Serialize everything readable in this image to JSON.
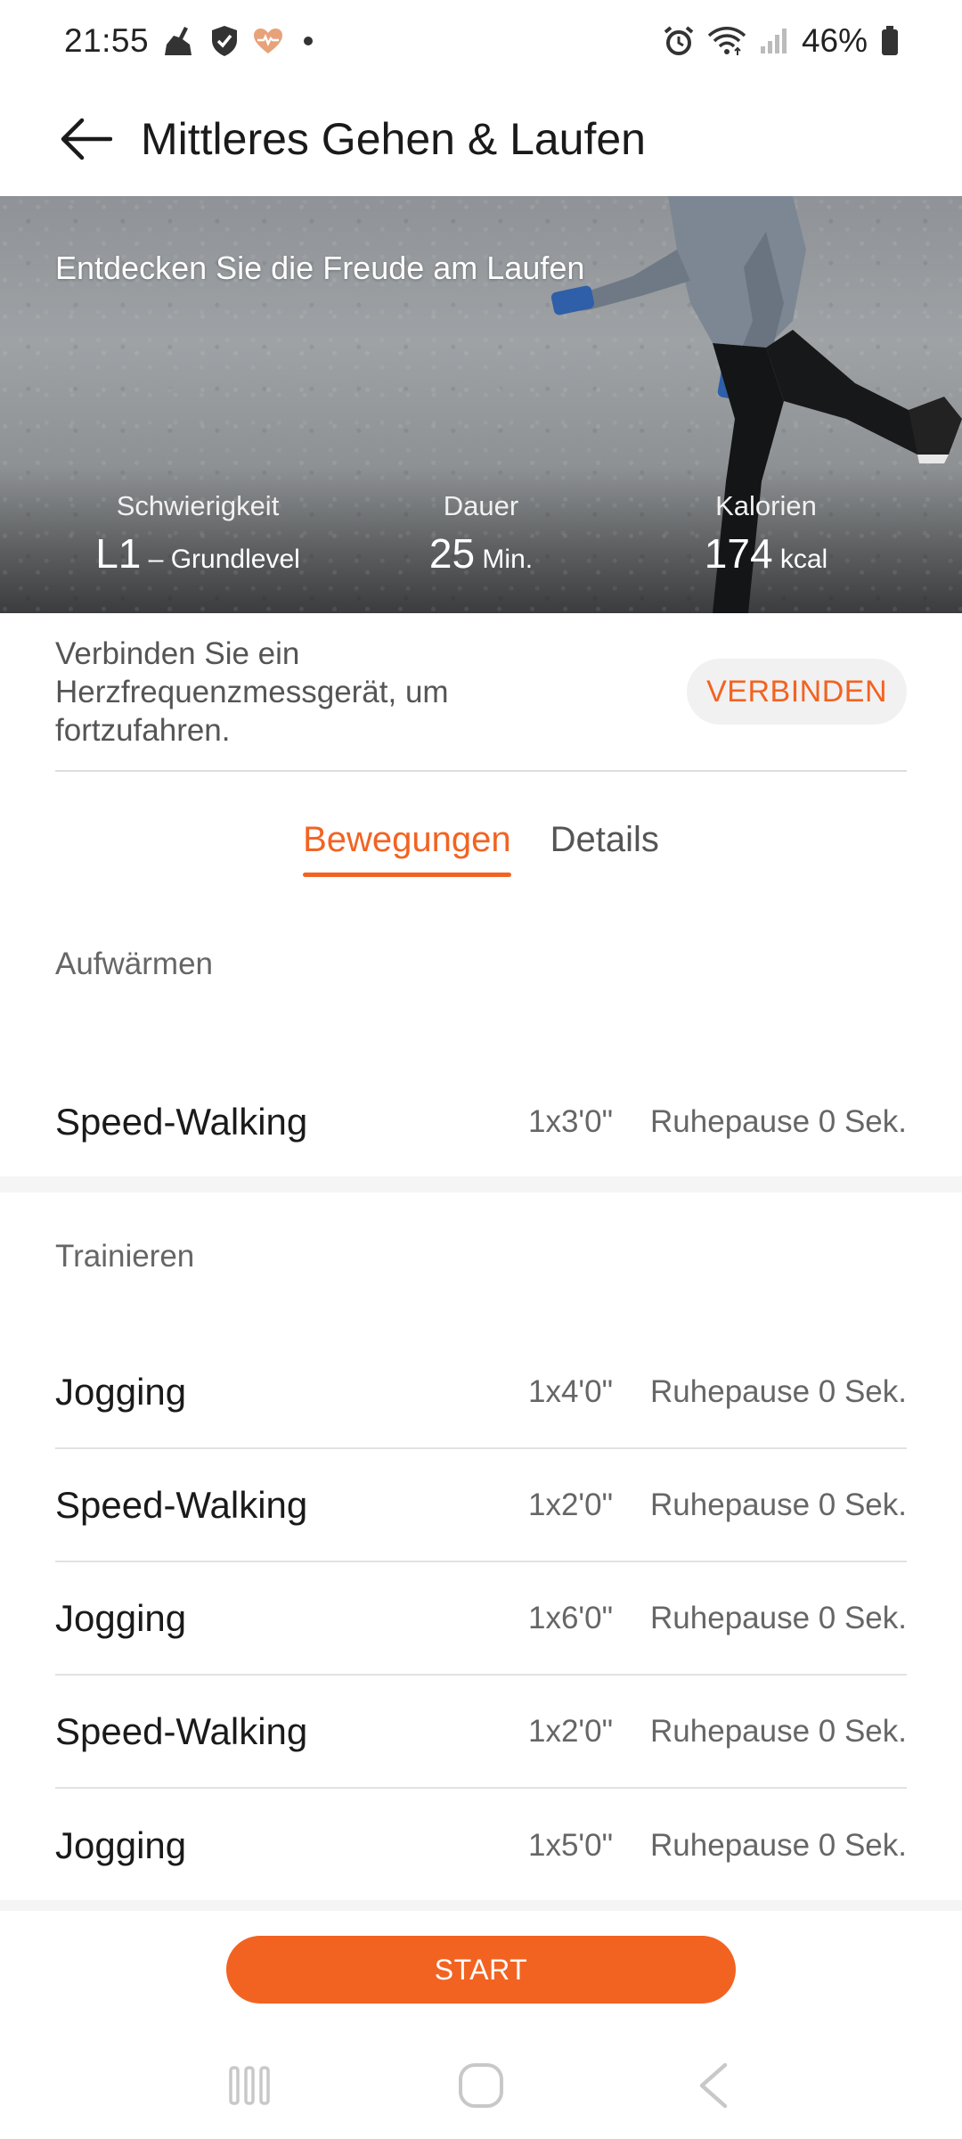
{
  "status_bar": {
    "time": "21:55",
    "battery_percent": "46%",
    "icons_left": [
      "broom-icon",
      "shield-icon",
      "heart-rate-icon",
      "dot-icon"
    ],
    "icons_right": [
      "alarm-icon",
      "wifi-icon",
      "signal-icon",
      "battery-icon"
    ]
  },
  "app_bar": {
    "title": "Mittleres Gehen & Laufen",
    "back_icon": "arrow-left-icon"
  },
  "hero": {
    "tagline": "Entdecken Sie die Freude am Laufen",
    "stats": [
      {
        "label": "Schwierigkeit",
        "value": "L1",
        "unit": " – Grundlevel"
      },
      {
        "label": "Dauer",
        "value": "25",
        "unit": " Min."
      },
      {
        "label": "Kalorien",
        "value": "174",
        "unit": " kcal"
      }
    ]
  },
  "connect": {
    "text": "Verbinden Sie ein Herzfrequenzmessgerät, um fortzufahren.",
    "button": "VERBINDEN"
  },
  "tabs": [
    {
      "label": "Bewegungen",
      "active": true
    },
    {
      "label": "Details",
      "active": false
    }
  ],
  "sections": [
    {
      "title": "Aufwärmen",
      "rows": [
        {
          "name": "Speed-Walking",
          "sets": "1x3'0\"",
          "rest": "Ruhepause 0 Sek."
        }
      ]
    },
    {
      "title": "Trainieren",
      "rows": [
        {
          "name": "Jogging",
          "sets": "1x4'0\"",
          "rest": "Ruhepause 0 Sek."
        },
        {
          "name": "Speed-Walking",
          "sets": "1x2'0\"",
          "rest": "Ruhepause 0 Sek."
        },
        {
          "name": "Jogging",
          "sets": "1x6'0\"",
          "rest": "Ruhepause 0 Sek."
        },
        {
          "name": "Speed-Walking",
          "sets": "1x2'0\"",
          "rest": "Ruhepause 0 Sek."
        },
        {
          "name": "Jogging",
          "sets": "1x5'0\"",
          "rest": "Ruhepause 0 Sek."
        }
      ]
    }
  ],
  "start_button": "START",
  "nav": {
    "recents_icon": "recents-icon",
    "home_icon": "home-icon",
    "back_icon": "nav-back-icon"
  },
  "colors": {
    "accent": "#f26322",
    "text_primary": "#1a1a1a",
    "text_secondary": "#666666",
    "divider": "#e2e2e2"
  }
}
